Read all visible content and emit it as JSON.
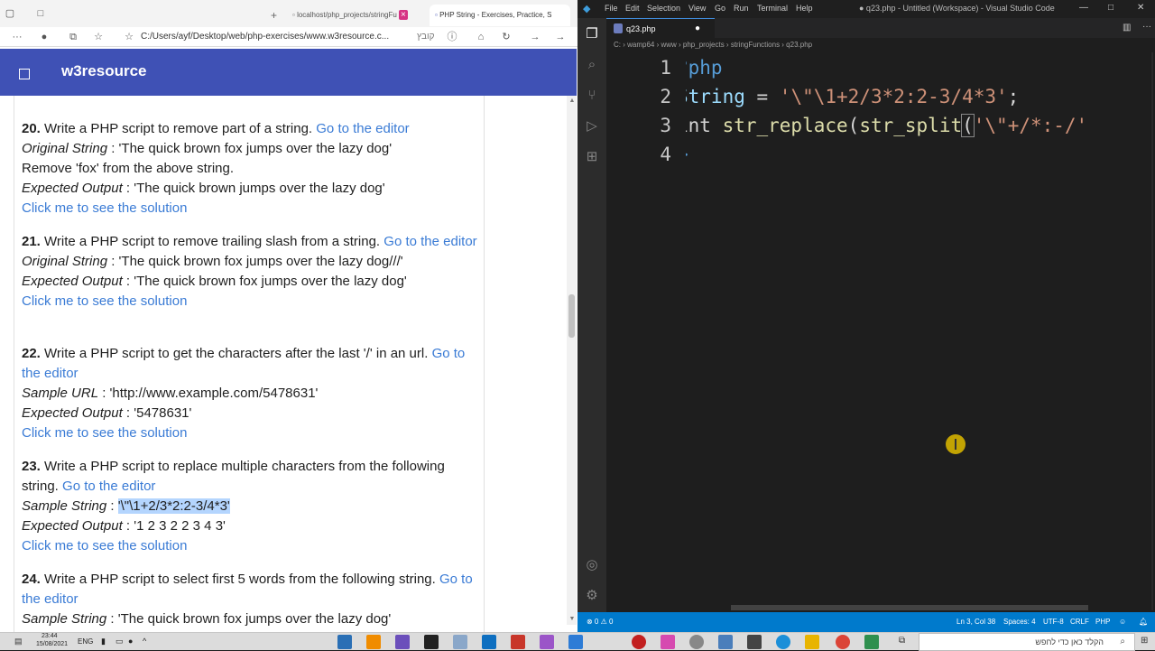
{
  "browser": {
    "tabs": [
      {
        "label": "localhost/php_projects/stringFu"
      },
      {
        "label": "PHP String - Exercises, Practice, S"
      }
    ],
    "address": "C:/Users/ayf/Desktop/web/php-exercises/www.w3resource.c...",
    "address_hint": "קובץ",
    "site_name": "w3resource",
    "link_editor": "Go to the editor",
    "link_solution": "Click me to see the solution",
    "questions": [
      {
        "num": "20.",
        "text": "Write a PHP script to remove part of a string.",
        "lines": [
          {
            "label": "Original String",
            "value": ": 'The quick brown fox jumps over the lazy dog'"
          },
          {
            "label": "",
            "value": "Remove 'fox' from the above string."
          },
          {
            "label": "Expected Output",
            "value": ": 'The quick brown jumps over the lazy dog'"
          }
        ]
      },
      {
        "num": "21.",
        "text": "Write a PHP script to remove trailing slash from a string.",
        "lines": [
          {
            "label": "Original String",
            "value": ": 'The quick brown fox jumps over the lazy dog///'"
          },
          {
            "label": "Expected Output",
            "value": ": 'The quick brown fox jumps over the lazy dog'"
          }
        ]
      },
      {
        "num": "22.",
        "text": "Write a PHP script to get the characters after the last '/' in an url.",
        "lines": [
          {
            "label": "Sample URL",
            "value": ": 'http://www.example.com/5478631'"
          },
          {
            "label": "Expected Output",
            "value": ": '5478631'"
          }
        ]
      },
      {
        "num": "23.",
        "text": "Write a PHP script to replace multiple characters from the following string.",
        "sample_label": "Sample String",
        "sample_sep": " : ",
        "sample_value": "'\\\"\\1+2/3*2:2-3/4*3'",
        "lines": [
          {
            "label": "Expected Output",
            "value": ": '1 2 3 2 2 3 4 3'"
          }
        ]
      },
      {
        "num": "24.",
        "text": "Write a PHP script to select first 5 words from the following string.",
        "lines": [
          {
            "label": "Sample String",
            "value": ": 'The quick brown fox jumps over the lazy dog'"
          }
        ]
      }
    ]
  },
  "vscode": {
    "menu": [
      "File",
      "Edit",
      "Selection",
      "View",
      "Go",
      "Run",
      "Terminal",
      "Help"
    ],
    "window_title": "● q23.php - Untitled (Workspace) - Visual Studio Code",
    "tab_label": "q23.php",
    "breadcrumb": "C: › wamp64 › www › php_projects › stringFunctions › q23.php",
    "line_numbers": [
      "1",
      "2",
      "3",
      "4"
    ],
    "code": {
      "l1": "?php",
      "l2_var": "String",
      "l2_op": " = ",
      "l2_str": "'\\\"\\1+2/3*2:2-3/4*3'",
      "l2_end": ";",
      "l3_kw": "int ",
      "l3_fn1": "str_replace",
      "l3_p1": "(",
      "l3_fn2": "str_split",
      "l3_p2": "(",
      "l3_str": "'\\\"+/*:-/'",
      "l4": ">"
    },
    "status": {
      "problems": "⊗ 0 ⚠ 0",
      "position": "Ln 3, Col 38",
      "spaces": "Spaces: 4",
      "encoding": "UTF-8",
      "eol": "CRLF",
      "language": "PHP"
    }
  },
  "taskbar": {
    "time": "23:44",
    "date": "15/08/2021",
    "lang": "ENG",
    "search_placeholder": "הקלד כאן כדי לחפש"
  }
}
